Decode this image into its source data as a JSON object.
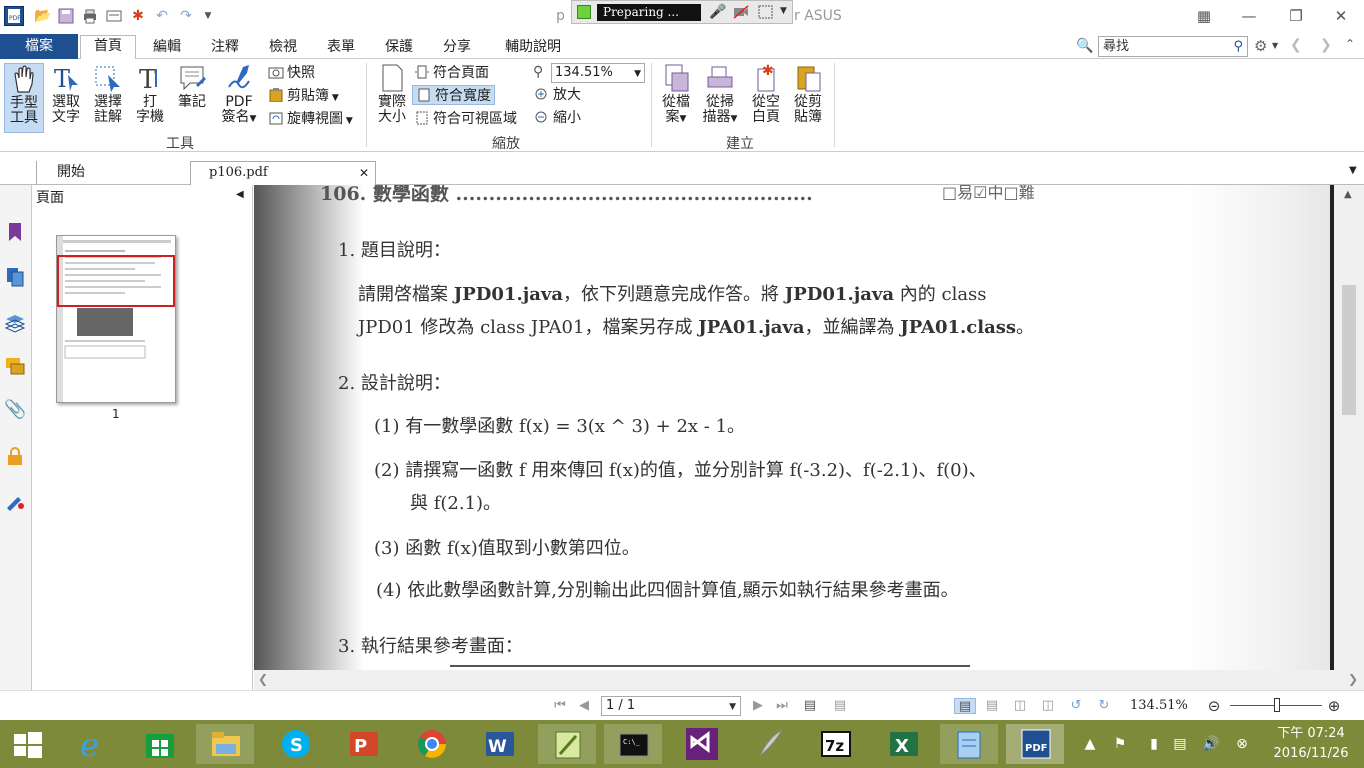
{
  "window": {
    "title": "p106.pdf - Foxit Reader ASUS",
    "title_visible_left": "p",
    "title_visible_right": "r ASUS"
  },
  "recorder": {
    "status": "Preparing ..."
  },
  "menu": {
    "file": "檔案",
    "tabs": [
      "首頁",
      "編輯",
      "注釋",
      "檢視",
      "表單",
      "保護",
      "分享",
      "輔助說明"
    ],
    "active_tab": "首頁",
    "search_placeholder": "尋找"
  },
  "ribbon": {
    "tools": {
      "hand_line1": "手型",
      "hand_line2": "工具",
      "select_text_line1": "選取",
      "select_text_line2": "文字",
      "select_annot_line1": "選擇",
      "select_annot_line2": "註解",
      "typewriter_line1": "打",
      "typewriter_line2": "字機",
      "note": "筆記",
      "pdf_sign_line1": "PDF",
      "pdf_sign_line2": "簽名",
      "snapshot": "快照",
      "clipboard": "剪貼簿",
      "rotate": "旋轉視圖",
      "group_label": "工具"
    },
    "zoom": {
      "actual_size_line1": "實際",
      "actual_size_line2": "大小",
      "fit_page": "符合頁面",
      "fit_width": "符合寬度",
      "fit_visible": "符合可視區域",
      "zoom_value": "134.51%",
      "zoom_in": "放大",
      "zoom_out": "縮小",
      "group_label": "縮放"
    },
    "create": {
      "from_file_line1": "從檔",
      "from_file_line2": "案",
      "from_scanner_line1": "從掃",
      "from_scanner_line2": "描器",
      "from_blank_line1": "從空",
      "from_blank_line2": "白頁",
      "from_clipboard_line1": "從剪",
      "from_clipboard_line2": "貼簿",
      "group_label": "建立"
    }
  },
  "doc_tabs": {
    "start": "開始",
    "file": "p106.pdf"
  },
  "pages_panel": {
    "title": "頁面",
    "thumb_page": "1"
  },
  "document": {
    "header": "106. 數學函數 ......................................................",
    "difficulty": "□易☑中□難",
    "sec1_title": "1. 題目說明：",
    "sec1_p1_a": "請開啓檔案",
    "sec1_p1_b": "JPD01.java",
    "sec1_p1_c": "，依下列題意完成作答。將",
    "sec1_p1_d": "JPD01.java",
    "sec1_p1_e": "內的 class",
    "sec1_p2_a": "JPD01 修改為 class JPA01，檔案另存成",
    "sec1_p2_b": "JPA01.java",
    "sec1_p2_c": "，並編譯為",
    "sec1_p2_d": "JPA01.class",
    "sec1_p2_e": "。",
    "sec2_title": "2. 設計說明：",
    "item1": "(1) 有一數學函數 f(x) = 3(x ^ 3) + 2x - 1。",
    "item2_l1": "(2) 請撰寫一函數 f 用來傳回 f(x)的值，並分別計算 f(-3.2)、f(-2.1)、f(0)、",
    "item2_l2": "與 f(2.1)。",
    "item3": "(3) 函數 f(x)值取到小數第四位。",
    "item4": "(4) 依此數學函數計算,分別輸出此四個計算值,顯示如執行結果參考畫面。",
    "sec3_title": "3. 執行結果參考畫面："
  },
  "status": {
    "page": "1 / 1",
    "zoom": "134.51%"
  },
  "taskbar": {
    "clock_time": "下午 07:24",
    "clock_date": "2016/11/26"
  }
}
